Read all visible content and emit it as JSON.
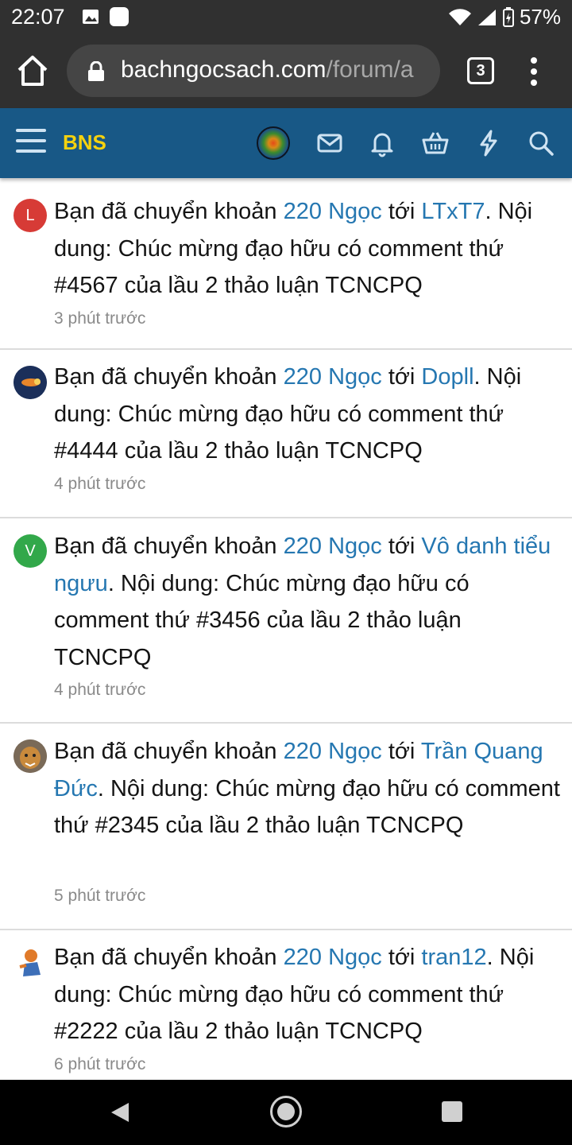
{
  "status_bar": {
    "time": "22:07",
    "battery": "57%"
  },
  "browser": {
    "url_domain": "bachngocsach.com",
    "url_path": "/forum/a",
    "tab_count": "3"
  },
  "header": {
    "brand": "BNS"
  },
  "feed": [
    {
      "avatar_letter": "L",
      "avatar_color": "#d73b36",
      "prefix": "Bạn đã chuyển khoản ",
      "amount": "220 Ngọc",
      "mid": " tới ",
      "recipient": "LTxT7",
      "suffix": ". Nội dung: Chúc mừng đạo hữu có comment thứ #4567 của lầu 2 thảo luận TCNCPQ",
      "time": "3 phút trước"
    },
    {
      "avatar_letter": "",
      "avatar_color": "#1b2f5a",
      "prefix": "Bạn đã chuyển khoản ",
      "amount": "220 Ngọc",
      "mid": " tới ",
      "recipient": "Dopll",
      "suffix": ". Nội dung: Chúc mừng đạo hữu có comment thứ #4444 của lầu 2 thảo luận TCNCPQ",
      "time": "4 phút trước"
    },
    {
      "avatar_letter": "V",
      "avatar_color": "#32a84a",
      "prefix": "Bạn đã chuyển khoản ",
      "amount": "220 Ngọc",
      "mid": " tới ",
      "recipient": "Vô danh tiểu ngưu",
      "suffix": ". Nội dung: Chúc mừng đạo hữu có comment thứ #3456 của lầu 2 thảo luận TCNCPQ",
      "time": "4 phút trước"
    },
    {
      "avatar_letter": "",
      "avatar_color": "#6b5a48",
      "prefix": "Bạn đã chuyển khoản ",
      "amount": "220 Ngọc",
      "mid": " tới ",
      "recipient": "Trần Quang Đức",
      "suffix": ". Nội dung: Chúc mừng đạo hữu có comment thứ #2345 của lầu 2 thảo luận TCNCPQ",
      "time": "5 phút trước"
    },
    {
      "avatar_letter": "",
      "avatar_color": "#ffffff",
      "prefix": "Bạn đã chuyển khoản ",
      "amount": "220 Ngọc",
      "mid": " tới ",
      "recipient": "tran12",
      "suffix": ". Nội dung: Chúc mừng đạo hữu có comment thứ #2222 của lầu 2 thảo luận TCNCPQ",
      "time": "6 phút trước"
    }
  ]
}
